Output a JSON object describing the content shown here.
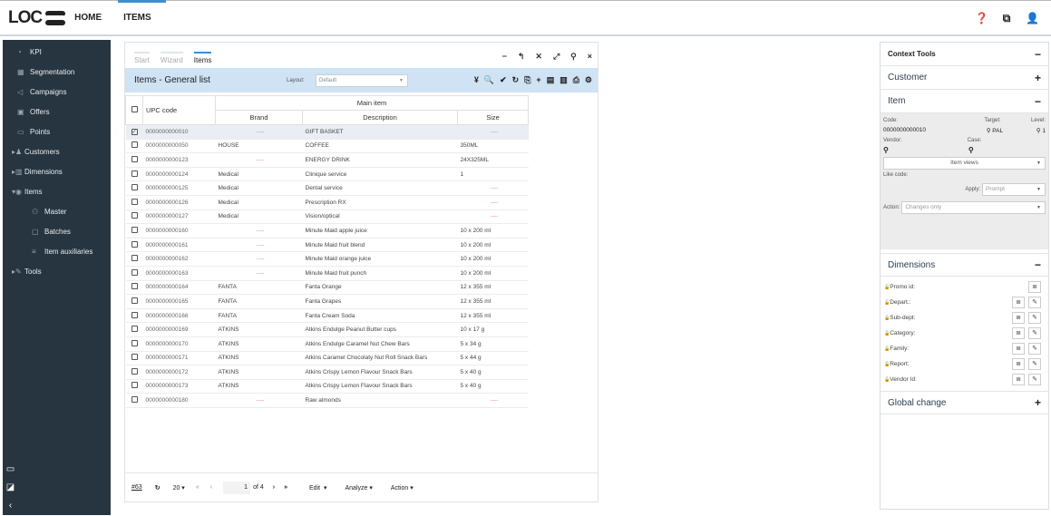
{
  "app": {
    "logo": "LOC",
    "nav_home": "HOME",
    "nav_items": "ITEMS"
  },
  "top_icons": [
    "help-icon",
    "windows-icon",
    "user-icon"
  ],
  "sidebar": {
    "items": [
      {
        "label": "KPI",
        "icon": "dashboard-icon"
      },
      {
        "label": "Segmentation",
        "icon": "grid-icon"
      },
      {
        "label": "Campaigns",
        "icon": "megaphone-icon"
      },
      {
        "label": "Offers",
        "icon": "gift-icon"
      },
      {
        "label": "Points",
        "icon": "card-icon"
      },
      {
        "label": "Customers",
        "icon": "users-icon"
      },
      {
        "label": "Dimensions",
        "icon": "chart-icon"
      },
      {
        "label": "Items",
        "icon": "tag-icon"
      },
      {
        "label": "Master",
        "icon": "master-icon"
      },
      {
        "label": "Batches",
        "icon": "batch-icon"
      },
      {
        "label": "Item auxiliaries",
        "icon": "list-icon"
      },
      {
        "label": "Tools",
        "icon": "wrench-icon"
      }
    ]
  },
  "main": {
    "tabs": [
      "Start",
      "Wizard",
      "Items"
    ],
    "title": "Items - General list",
    "layout_label": "Layout:",
    "layout_value": "Default",
    "col_upc": "UPC code",
    "col_main": "Main item",
    "col_brand": "Brand",
    "col_desc": "Description",
    "col_size": "Size",
    "rows": [
      {
        "code": "0000000000010",
        "brand": "",
        "desc": "GIFT BASKET",
        "size": ""
      },
      {
        "code": "0000000000050",
        "brand": "HOUSE",
        "desc": "COFFEE",
        "size": "350ML"
      },
      {
        "code": "0000000000123",
        "brand": "",
        "desc": "ENERGY DRINK",
        "size": "24X325ML"
      },
      {
        "code": "0000000000124",
        "brand": "Medical",
        "desc": "Clinique service",
        "size": "1"
      },
      {
        "code": "0000000000125",
        "brand": "Medical",
        "desc": "Dental service",
        "size": ""
      },
      {
        "code": "0000000000126",
        "brand": "Medical",
        "desc": "Prescription RX",
        "size": ""
      },
      {
        "code": "0000000000127",
        "brand": "Medical",
        "desc": "Vision/optical",
        "size": ""
      },
      {
        "code": "0000000000160",
        "brand": "",
        "desc": "Minute Maid apple juice",
        "size": "10 x 200 ml"
      },
      {
        "code": "0000000000161",
        "brand": "",
        "desc": "Minute Maid fruit blend",
        "size": "10 x 200 ml"
      },
      {
        "code": "0000000000162",
        "brand": "",
        "desc": "Minute Maid orange juice",
        "size": "10 x 200 ml"
      },
      {
        "code": "0000000000163",
        "brand": "",
        "desc": "Minute Maid fruit punch",
        "size": "10 x 200 ml"
      },
      {
        "code": "0000000000164",
        "brand": "FANTA",
        "desc": "Fanta Orange",
        "size": "12 x 355 ml"
      },
      {
        "code": "0000000000165",
        "brand": "FANTA",
        "desc": "Fanta Grapes",
        "size": "12 x 355 ml"
      },
      {
        "code": "0000000000166",
        "brand": "FANTA",
        "desc": "Fanta Cream Soda",
        "size": "12 x 355 ml"
      },
      {
        "code": "0000000000169",
        "brand": "ATKINS",
        "desc": "Atkins Endulge Peanut Butter cups",
        "size": "10 x 17 g"
      },
      {
        "code": "0000000000170",
        "brand": "ATKINS",
        "desc": "Atkins Endulge Caramel Nut Chew Bars",
        "size": "5 x 34 g"
      },
      {
        "code": "0000000000171",
        "brand": "ATKINS",
        "desc": "Atkins Caramel Chocolaty Nut Roll Snack Bars",
        "size": "5 x 44 g"
      },
      {
        "code": "0000000000172",
        "brand": "ATKINS",
        "desc": "Atkins Crispy Lemon Flavour Snack Bars",
        "size": "5 x 40 g"
      },
      {
        "code": "0000000000173",
        "brand": "ATKINS",
        "desc": "Atkins Crispy Lemon Flavour Snack Bars",
        "size": "5 x 40 g"
      },
      {
        "code": "0000000000180",
        "brand": "",
        "desc": "Raw almonds",
        "size": ""
      }
    ],
    "pager": {
      "count": "#63",
      "page_size": "20",
      "page": "1",
      "of": "of 4",
      "edit": "Edit",
      "analyze": "Analyze",
      "action": "Action"
    }
  },
  "right": {
    "title": "Context Tools",
    "customer": "Customer",
    "item": "Item",
    "code_label": "Code:",
    "code_value": "0000000000010",
    "target_label": "Target:",
    "target_value": "PAL",
    "level_label": "Level:",
    "level_value": "1",
    "vendor_label": "Vendor:",
    "case_label": "Case:",
    "item_views": "Item views",
    "like_code": "Like code:",
    "apply_label": "Apply:",
    "apply_value": "Prompt",
    "action_label": "Action:",
    "action_value": "Changes only",
    "dimensions": "Dimensions",
    "dims": [
      "Promo id:",
      "Depart.:",
      "Sub-dept:",
      "Category:",
      "Family:",
      "Report:",
      "Vendor Id:"
    ],
    "global_change": "Global change"
  }
}
